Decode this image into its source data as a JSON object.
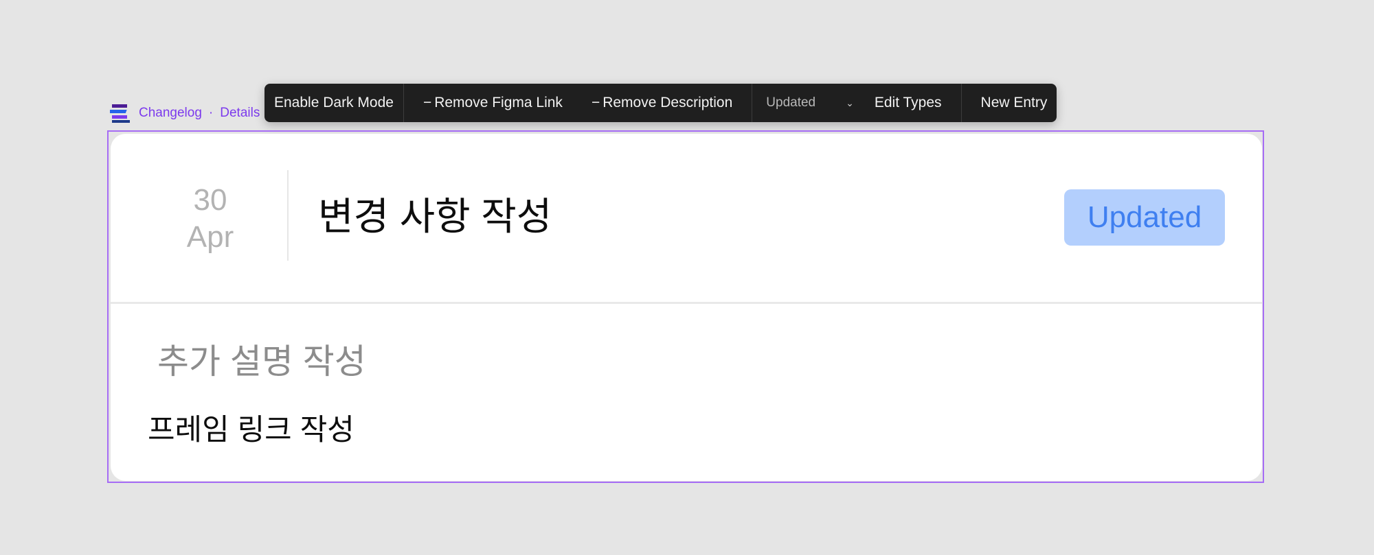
{
  "breadcrumb": {
    "app": "Changelog",
    "separator": "·",
    "page": "Details"
  },
  "toolbar": {
    "dark_mode": "Enable Dark Mode",
    "remove_figma": "Remove Figma Link",
    "remove_description": "Remove Description",
    "minus": "−",
    "type_select_value": "Updated",
    "chevron": "⌄",
    "edit_types": "Edit Types",
    "new_entry": "New Entry"
  },
  "entry": {
    "day": "30",
    "month": "Apr",
    "title": "변경 사항 작성",
    "badge": "Updated",
    "description": "추가 설명 작성",
    "frame_link": "프레임 링크 작성"
  },
  "colors": {
    "accent": "#7c3aed",
    "frame_outline": "#a66cf5",
    "badge_bg": "#b3cffd",
    "badge_text": "#3f7ff0",
    "toolbar_bg": "#1f1f1f"
  }
}
